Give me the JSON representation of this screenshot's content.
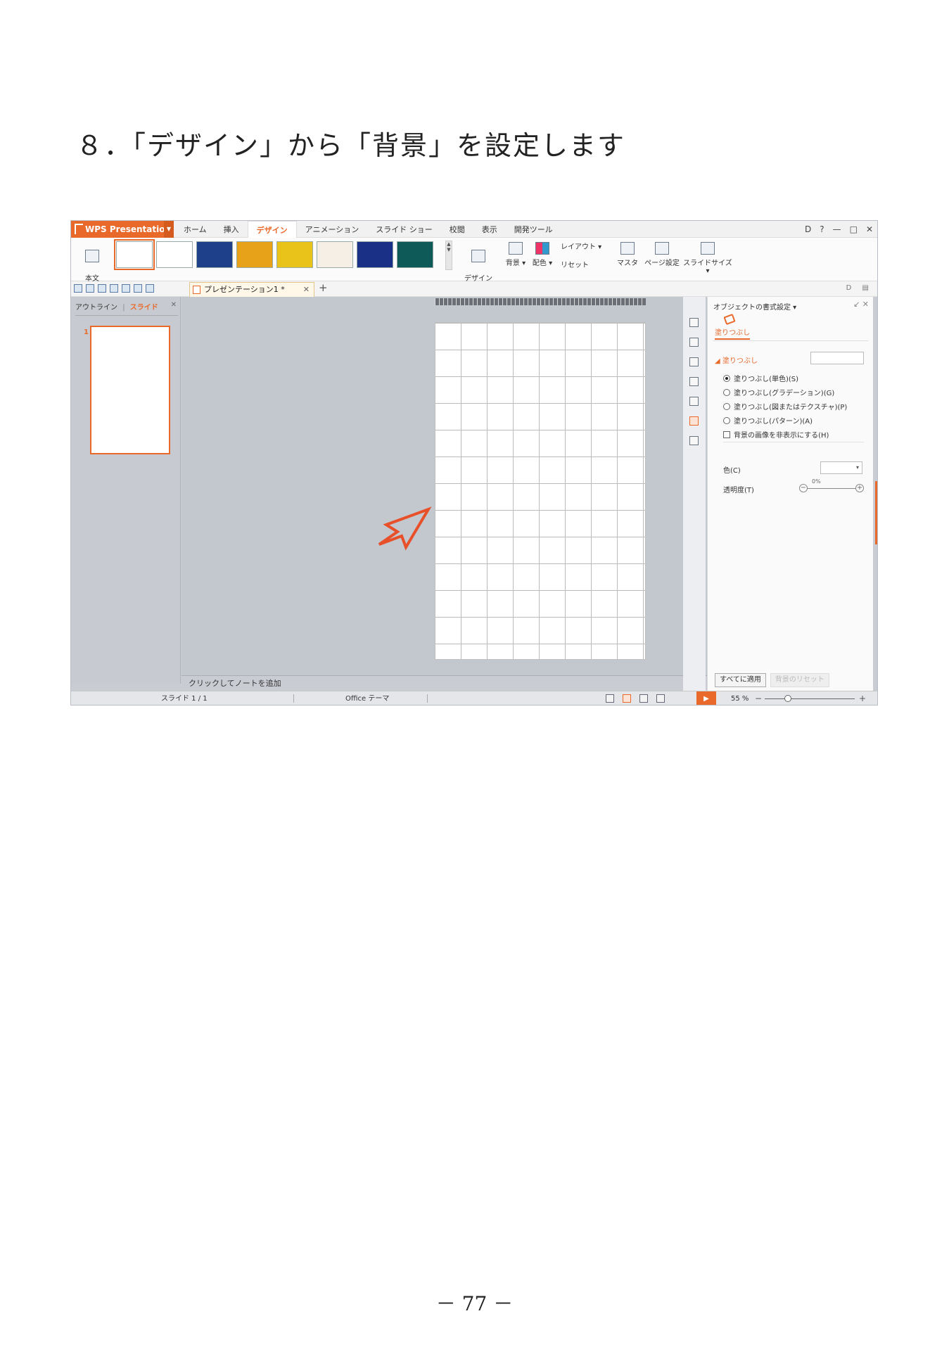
{
  "heading": "８．「デザイン」から「背景」を設定します",
  "page_number": "－ 77 －",
  "app": {
    "brand_label": "WPS Presentation",
    "menu_tabs": [
      "ホーム",
      "挿入",
      "デザイン",
      "アニメーション",
      "スライド ショー",
      "校閲",
      "表示",
      "開発ツール"
    ],
    "active_tab": "デザイン",
    "window_controls": [
      "D",
      "?",
      "—",
      "□",
      "✕"
    ],
    "ribbon": {
      "body_template_label": "本文\nテンプレート",
      "design_template_label": "デザイン\nテンプレート",
      "background_label": "背景 ▾",
      "color_scheme_label": "配色 ▾",
      "layout_label": "レイアウト ▾",
      "reset_label": "リセット",
      "master_label": "マスタ",
      "page_setup_label": "ページ設定",
      "slide_size_label": "スライドサイズ ▾"
    },
    "theme_thumbnails": [
      {
        "name": "selected-theme",
        "color": "#ffffff"
      },
      {
        "name": "white",
        "color": "#ffffff"
      },
      {
        "name": "blue",
        "color": "#1e3f8a"
      },
      {
        "name": "orange",
        "color": "#e8a21a"
      },
      {
        "name": "yellow",
        "color": "#e9c21a"
      },
      {
        "name": "light",
        "color": "#f6efe6"
      },
      {
        "name": "navy",
        "color": "#1a2f86"
      },
      {
        "name": "teal",
        "color": "#0d5a58"
      }
    ],
    "document_tab": "プレゼンテーション1 *",
    "left_pane": {
      "outline_tab": "アウトライン",
      "slides_tab": "スライド",
      "slide_number": "1"
    },
    "notes_placeholder": "クリックしてノートを追加",
    "task_pane": {
      "title": "オブジェクトの書式設定 ▾",
      "tab_label": "塗りつぶし",
      "section_label": "◢ 塗りつぶし",
      "options": [
        {
          "label": "塗りつぶし(単色)(S)",
          "selected": true
        },
        {
          "label": "塗りつぶし(グラデーション)(G)",
          "selected": false
        },
        {
          "label": "塗りつぶし(図またはテクスチャ)(P)",
          "selected": false
        },
        {
          "label": "塗りつぶし(パターン)(A)",
          "selected": false
        }
      ],
      "hide_bg_label": "背景の画像を非表示にする(H)",
      "color_label": "色(C)",
      "transparency_label": "透明度(T)",
      "transparency_value": "0%",
      "apply_all_button": "すべてに適用",
      "reset_bg_button": "背景のリセット"
    },
    "status": {
      "slide_count": "スライド 1 / 1",
      "theme": "Office テーマ",
      "zoom": "55 %"
    }
  }
}
